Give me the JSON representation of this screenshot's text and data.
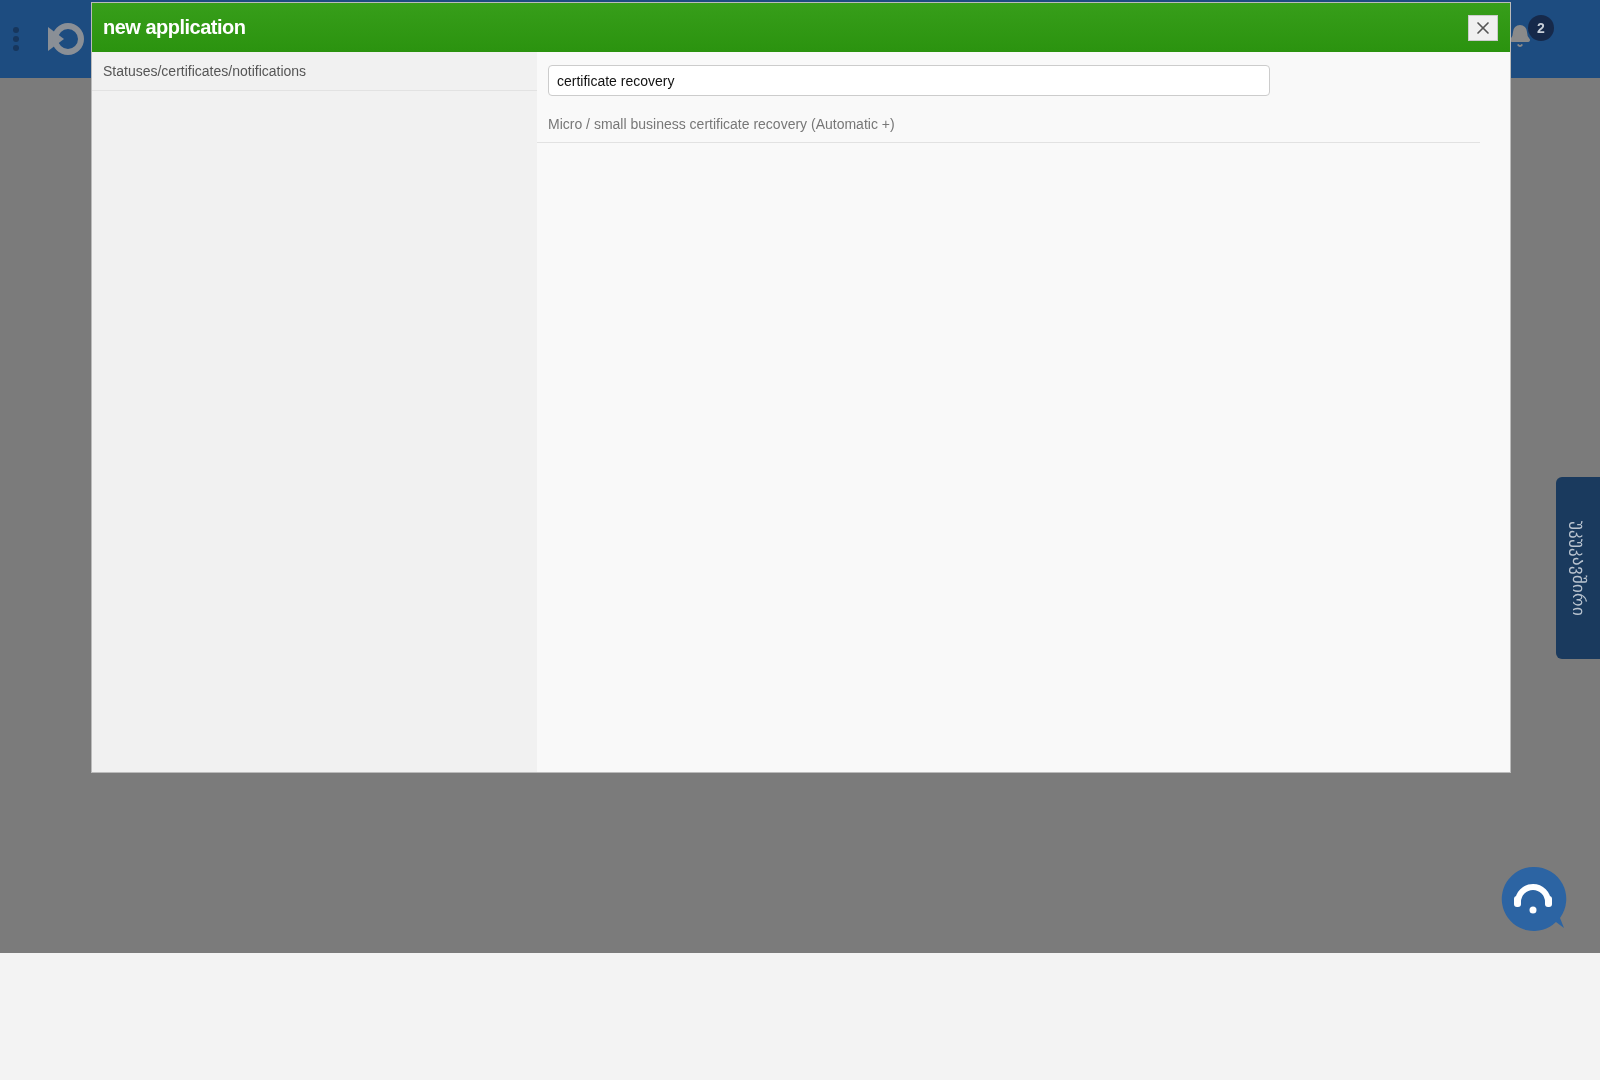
{
  "header": {
    "notification_count": "2"
  },
  "modal": {
    "title": "new application",
    "categories": [
      {
        "label": "Statuses/certificates/notifications"
      }
    ],
    "search": {
      "value": "certificate recovery"
    },
    "results": [
      {
        "label": "Micro / small business certificate recovery (Automatic +)"
      }
    ]
  },
  "feedback_tab": {
    "label": "უკუკავშირი"
  }
}
